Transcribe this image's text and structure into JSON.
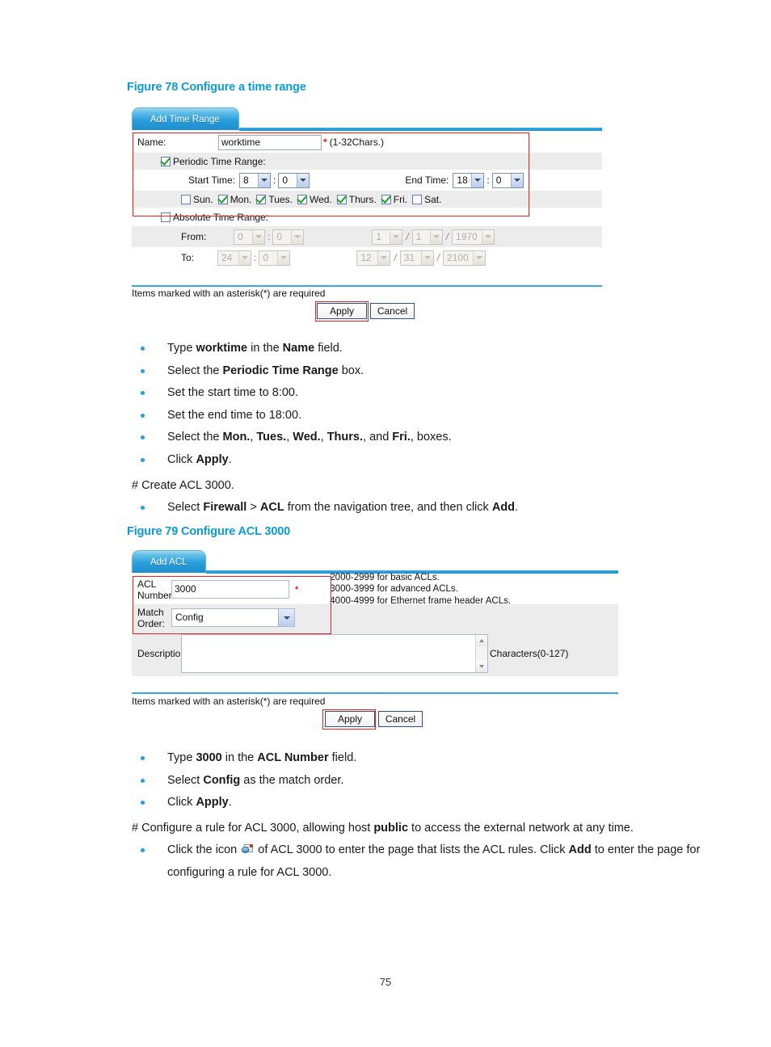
{
  "figure78": {
    "caption": "Figure 78 Configure a time range",
    "tab_label": "Add Time Range",
    "name_label": "Name:",
    "name_value": "worktime",
    "name_asterisk": "*",
    "name_hint": "(1-32Chars.)",
    "periodic_label": "Periodic Time Range:",
    "periodic_checked": true,
    "start_time_label": "Start Time:",
    "start_hour": "8",
    "start_minute": "0",
    "end_time_label": "End Time:",
    "end_hour": "18",
    "end_minute": "0",
    "colon": ":",
    "days": [
      {
        "label": "Sun.",
        "checked": false
      },
      {
        "label": "Mon.",
        "checked": true
      },
      {
        "label": "Tues.",
        "checked": true
      },
      {
        "label": "Wed.",
        "checked": true
      },
      {
        "label": "Thurs.",
        "checked": true
      },
      {
        "label": "Fri.",
        "checked": true
      },
      {
        "label": "Sat.",
        "checked": false
      }
    ],
    "absolute_label": "Absolute Time Range:",
    "absolute_checked": false,
    "from_label": "From:",
    "from_hour": "0",
    "from_minute": "0",
    "from_month": "1",
    "from_day": "1",
    "from_year": "1970",
    "to_label": "To:",
    "to_hour": "24",
    "to_minute": "0",
    "to_month": "12",
    "to_day": "31",
    "to_year": "2100",
    "slash": "/",
    "required_note": "Items marked with an asterisk(*) are required",
    "apply_label": "Apply",
    "cancel_label": "Cancel"
  },
  "steps1": [
    {
      "html": "Type <b>worktime</b> in the <b>Name</b> field."
    },
    {
      "html": "Select the <b>Periodic Time Range</b> box."
    },
    {
      "html": "Set the start time to 8:00."
    },
    {
      "html": "Set the end time to 18:00."
    },
    {
      "html": "Select the <b>Mon.</b>, <b>Tues.</b>, <b>Wed.</b>, <b>Thurs.</b>, and <b>Fri.</b>, boxes."
    },
    {
      "html": "Click <b>Apply</b>."
    }
  ],
  "para1": "# Create ACL 3000.",
  "steps2": [
    {
      "html": "Select <b>Firewall</b> &gt; <b>ACL</b> from the navigation tree, and then click <b>Add</b>."
    }
  ],
  "figure79": {
    "caption": "Figure 79 Configure ACL 3000",
    "tab_label": "Add ACL",
    "acl_number_label_line1": "ACL",
    "acl_number_label_line2": "Number:",
    "acl_number_value": "3000",
    "acl_asterisk": "*",
    "match_order_label_line1": "Match",
    "match_order_label_line2": "Order:",
    "match_order_value": "Config",
    "info_lines": [
      "2000-2999 for basic ACLs.",
      "3000-3999 for advanced ACLs.",
      "4000-4999 for Ethernet frame header ACLs."
    ],
    "description_label": "Description:",
    "description_value": "",
    "characters_hint": "Characters(0-127)",
    "required_note": "Items marked with an asterisk(*) are required",
    "apply_label": "Apply",
    "cancel_label": "Cancel"
  },
  "steps3": [
    {
      "html": "Type <b>3000</b> in the <b>ACL Number</b> field."
    },
    {
      "html": "Select <b>Config</b> as the match order."
    },
    {
      "html": "Click <b>Apply</b>."
    }
  ],
  "para2": "# Configure a rule for ACL 3000, allowing host <b>public</b> to access the external network at any time.",
  "steps4": [
    {
      "html": "Click the icon <span class=\"inline-icon\" data-name=\"acl-rules-icon\" data-interactable=\"false\"><span class=\"sheet\"></span><span class=\"node\"></span><span class=\"dotred\"></span></span> of ACL 3000 to enter the page that lists the ACL rules. Click <b>Add</b> to enter the page for configuring a rule for ACL 3000."
    }
  ],
  "page_number": "75",
  "colors": {
    "caption_blue": "#0c9ad8",
    "bullet_blue": "#1aa3dc",
    "highlight_red": "#e8201b",
    "asterisk_red": "#e21b1b",
    "row_gray": "#ececec",
    "panel_rule": "#36a8e0"
  }
}
